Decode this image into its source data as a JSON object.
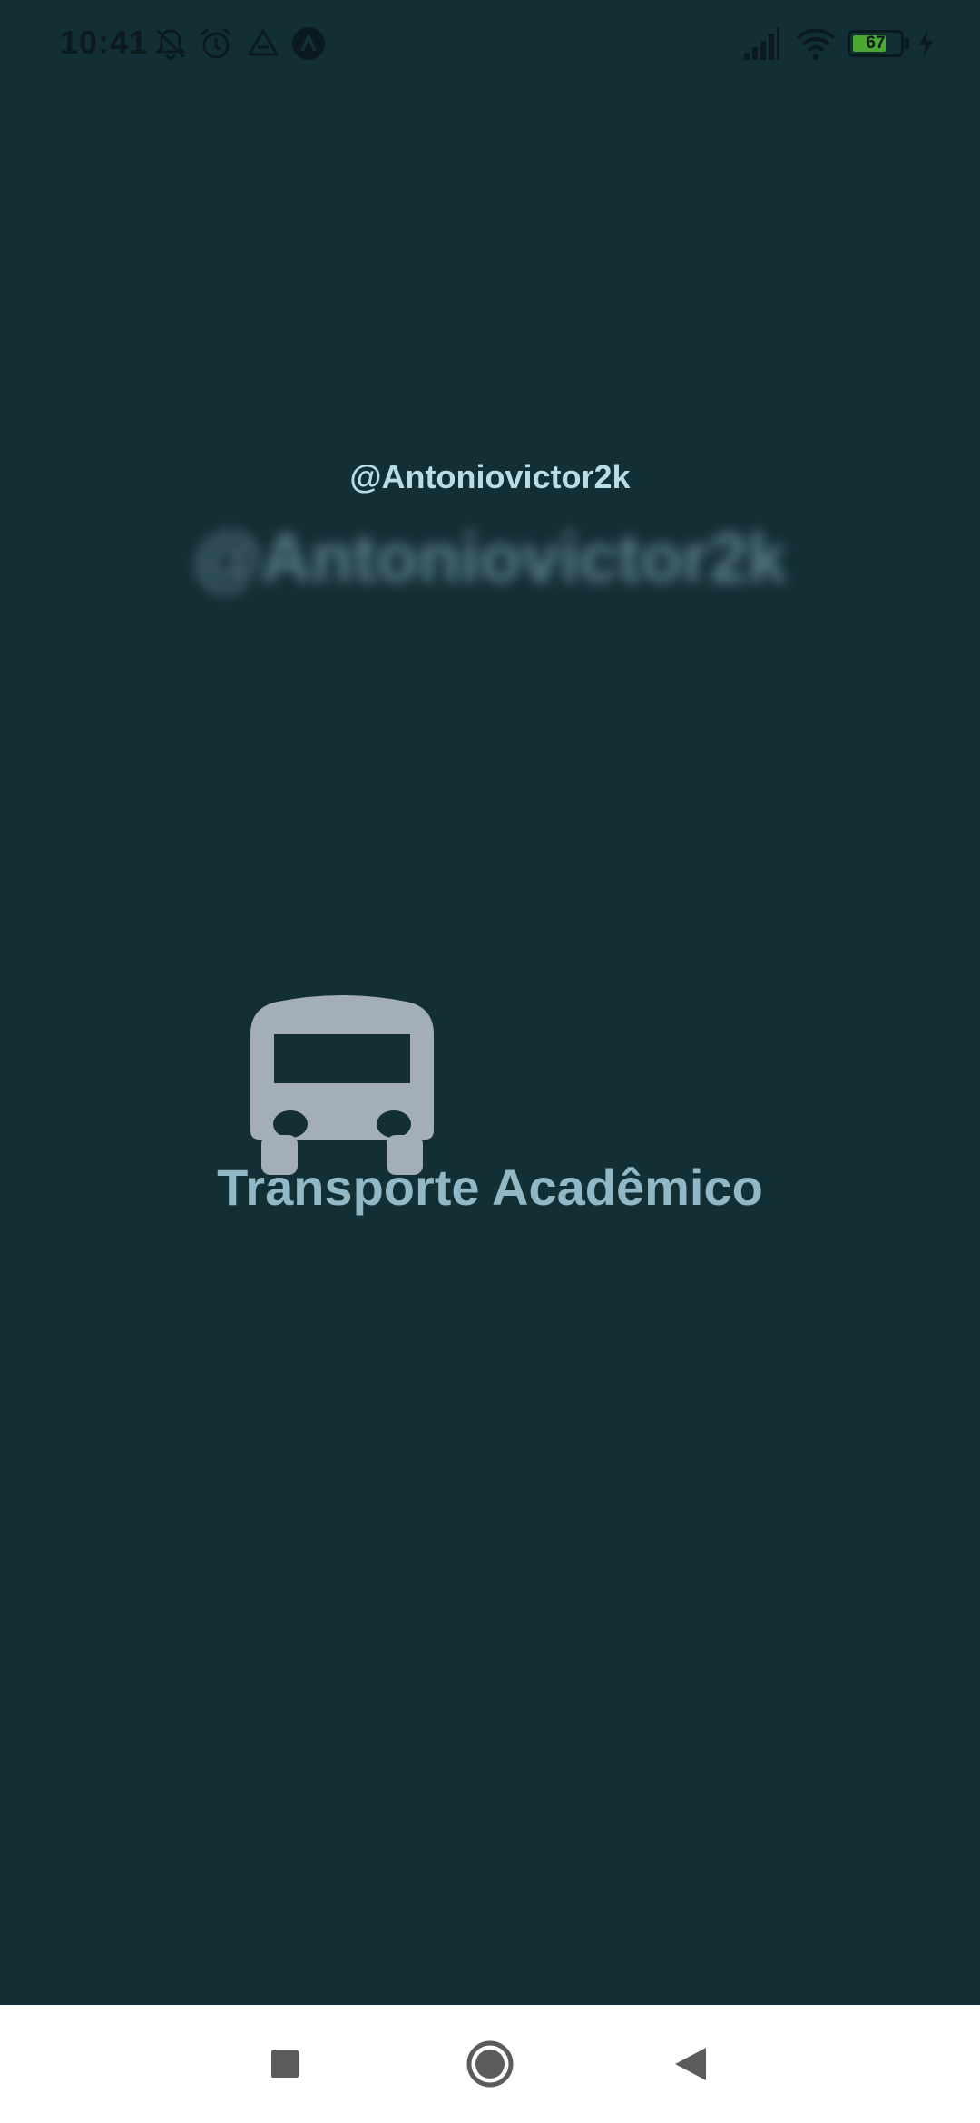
{
  "status_bar": {
    "time": "10:41",
    "battery_level": "67",
    "icons": [
      "notifications-off-icon",
      "alarm-icon",
      "drive-icon",
      "app-a-icon",
      "signal-icon",
      "wifi-icon",
      "battery-icon",
      "charging-icon"
    ]
  },
  "splash": {
    "handle": "@Antoniovictor2k",
    "handle_blurred": "@Antoniovictor2k",
    "app_title": "Transporte Acadêmico",
    "logo_icon": "bus-icon"
  },
  "colors": {
    "background": "#132f36",
    "title": "#91b8c4",
    "handle": "#b9dde6",
    "logo": "#a3aeb6",
    "nav_bar": "#ffffff"
  },
  "nav_bar": {
    "buttons": [
      "recents-button",
      "home-button",
      "back-button"
    ]
  }
}
